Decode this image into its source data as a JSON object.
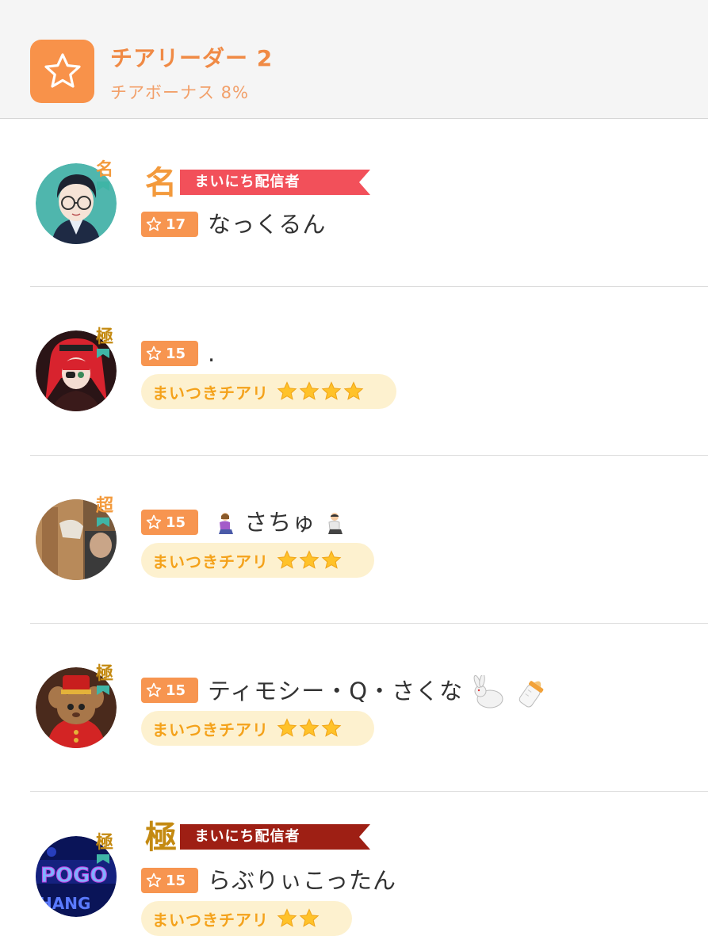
{
  "header": {
    "title": "チアリーダー 2",
    "subtitle": "チアボーナス 8%",
    "icon": "star-icon",
    "accent": "#f8924a"
  },
  "rows": [
    {
      "rank": "名",
      "rank_color": "#f39a3c",
      "title_kanji": "名",
      "title_label": "まいにち配信者",
      "title_color": "#f2505a",
      "level": "17",
      "name": "なっくるん",
      "cheer": null,
      "avatar": "avatar-anime-glasses"
    },
    {
      "rank": "極",
      "rank_color": "#c48a12",
      "level": "15",
      "name": ".",
      "cheer": "まいつきチアリ",
      "cheer_stars": 4,
      "avatar": "avatar-anime-red-hair"
    },
    {
      "rank": "超",
      "rank_color": "#f39a3c",
      "level": "15",
      "name": "さちゅ",
      "cheer": "まいつきチアリ",
      "cheer_stars": 3,
      "avatar": "avatar-photo"
    },
    {
      "rank": "極",
      "rank_color": "#c48a12",
      "level": "15",
      "name": "ティモシー・Q・さくな",
      "cheer": "まいつきチアリ",
      "cheer_stars": 3,
      "avatar": "avatar-mouse-character"
    },
    {
      "rank": "極",
      "rank_color": "#c48a12",
      "title_kanji": "極",
      "title_label": "まいにち配信者",
      "title_color": "#9e1f14",
      "level": "15",
      "name": "らぶりぃこったん",
      "cheer": "まいつきチアリ",
      "cheer_stars": 2,
      "avatar": "avatar-neon-sign"
    }
  ]
}
